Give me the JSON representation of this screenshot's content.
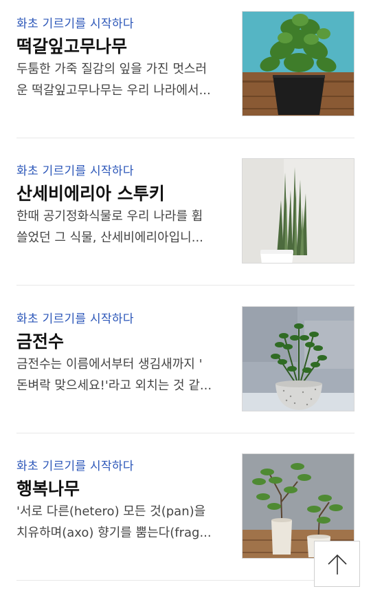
{
  "articles": [
    {
      "category": "화초 기르기를 시작하다",
      "title": "떡갈잎고무나무",
      "desc_line1": "두툼한 가죽 질감의 잎을 가진 멋스러",
      "desc_line2": "운 떡갈잎고무나무는 우리 나라에서...",
      "image": "fiddle-leaf-fig-photo"
    },
    {
      "category": "화초 기르기를 시작하다",
      "title": "산세비에리아 스투키",
      "desc_line1": "한때 공기정화식물로 우리 나라를 휩",
      "desc_line2": "쓸었던 그 식물, 산세비에리아입니...",
      "image": "sansevieria-stuckyi-photo"
    },
    {
      "category": "화초 기르기를 시작하다",
      "title": "금전수",
      "desc_line1": "금전수는 이름에서부터 생김새까지 '",
      "desc_line2": "돈벼락 맞으세요!'라고 외치는 것 같...",
      "image": "zz-plant-photo"
    },
    {
      "category": "화초 기르기를 시작하다",
      "title": "행복나무",
      "desc_line1": "'서로 다른(hetero) 모든 것(pan)을",
      "desc_line2": "치유하며(axo) 향기를 뿜는다(frag...",
      "image": "happiness-tree-photo"
    }
  ],
  "scroll_top_button": {
    "icon": "arrow-up-icon"
  }
}
